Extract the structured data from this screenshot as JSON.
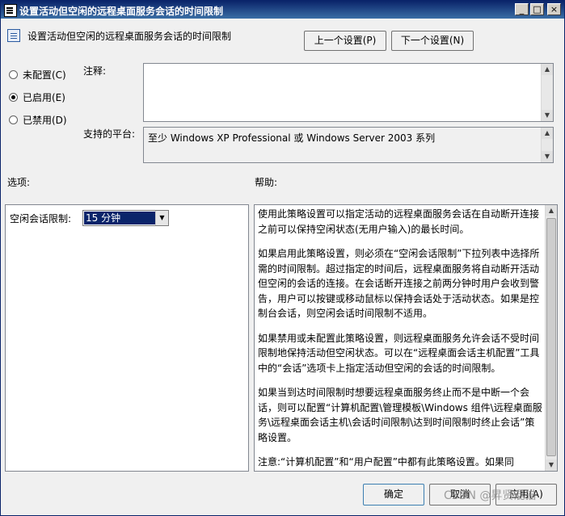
{
  "window": {
    "title": "设置活动但空闲的远程桌面服务会话的时间限制",
    "minimize": "_",
    "maximize": "□",
    "close": "×"
  },
  "header": {
    "setting_name": "设置活动但空闲的远程桌面服务会话的时间限制",
    "prev_button": "上一个设置(P)",
    "next_button": "下一个设置(N)"
  },
  "state": {
    "options": [
      {
        "label": "未配置(C)",
        "selected": false
      },
      {
        "label": "已启用(E)",
        "selected": true
      },
      {
        "label": "已禁用(D)",
        "selected": false
      }
    ]
  },
  "comment": {
    "label": "注释:",
    "value": ""
  },
  "platform": {
    "label": "支持的平台:",
    "value": "至少 Windows XP Professional 或 Windows Server 2003 系列"
  },
  "options_section": {
    "label": "选项:",
    "idle_limit_label": "空闲会话限制:",
    "idle_limit_value": "15 分钟"
  },
  "help_section": {
    "label": "帮助:",
    "paragraphs": [
      "使用此策略设置可以指定活动的远程桌面服务会话在自动断开连接之前可以保持空闲状态(无用户输入)的最长时间。",
      "如果启用此策略设置，则必须在“空闲会话限制”下拉列表中选择所需的时间限制。超过指定的时间后，远程桌面服务将自动断开活动但空闲的会话的连接。在会话断开连接之前两分钟时用户会收到警告，用户可以按键或移动鼠标以保持会话处于活动状态。如果是控制台会话，则空闲会话时间限制不适用。",
      "如果禁用或未配置此策略设置，则远程桌面服务允许会话不受时间限制地保持活动但空闲状态。可以在“远程桌面会话主机配置”工具中的“会话”选项卡上指定活动但空闲的会话的时间限制。",
      "如果当到达时间限制时想要远程桌面服务终止而不是中断一个会话，则可以配置“计算机配置\\管理模板\\Windows 组件\\远程桌面服务\\远程桌面会话主机\\会话时间限制\\达到时间限制时终止会话”策略设置。",
      "注意:“计算机配置”和“用户配置”中都有此策略设置。如果同"
    ]
  },
  "footer": {
    "ok_button": "确定",
    "cancel_button": "取消",
    "apply_button": "应用(A)"
  },
  "watermark": "CSDN @昇贤混猫"
}
